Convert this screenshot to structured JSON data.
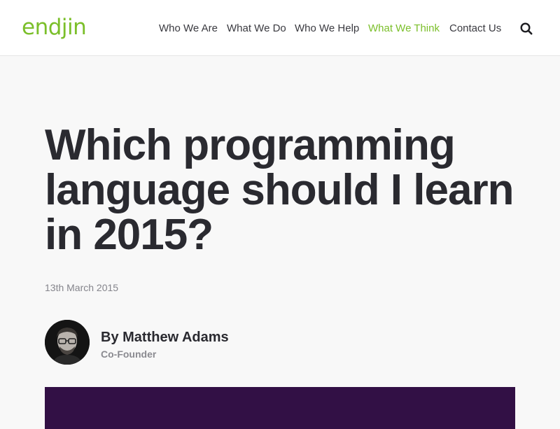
{
  "header": {
    "logo_text": "endjin",
    "nav": [
      {
        "label": "Who We Are",
        "active": false
      },
      {
        "label": "What We Do",
        "active": false
      },
      {
        "label": "Who We Help",
        "active": false
      },
      {
        "label": "What We Think",
        "active": true
      },
      {
        "label": "Contact Us",
        "active": false
      }
    ],
    "search_icon": "search-icon"
  },
  "article": {
    "title": "Which programming language should I learn in 2015?",
    "date": "13th March 2015",
    "author": {
      "name": "By Matthew Adams",
      "role": "Co-Founder",
      "avatar_icon": "avatar-photo"
    }
  },
  "colors": {
    "brand_green": "#7bbf2a",
    "banner_purple": "#321045",
    "text_dark": "#2a2a30",
    "text_muted": "#85858c"
  }
}
